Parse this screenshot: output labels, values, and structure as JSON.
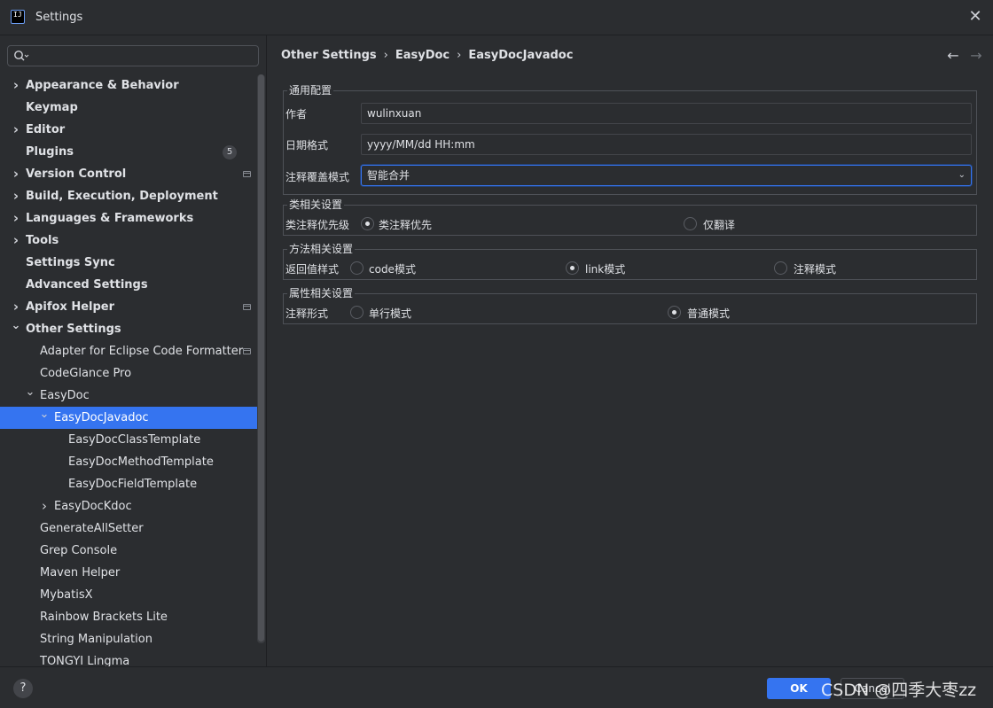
{
  "window": {
    "title": "Settings",
    "app_icon_text": "IJ"
  },
  "search": {
    "placeholder": "",
    "value": ""
  },
  "sidebar": {
    "items": [
      {
        "label": "Appearance & Behavior",
        "level": 0,
        "expandable": true,
        "expanded": false,
        "bold": true
      },
      {
        "label": "Keymap",
        "level": 0,
        "expandable": false,
        "bold": true
      },
      {
        "label": "Editor",
        "level": 0,
        "expandable": true,
        "expanded": false,
        "bold": true
      },
      {
        "label": "Plugins",
        "level": 0,
        "expandable": false,
        "bold": true,
        "badge": "5"
      },
      {
        "label": "Version Control",
        "level": 0,
        "expandable": true,
        "expanded": false,
        "bold": true,
        "project_icon": true
      },
      {
        "label": "Build, Execution, Deployment",
        "level": 0,
        "expandable": true,
        "expanded": false,
        "bold": true
      },
      {
        "label": "Languages & Frameworks",
        "level": 0,
        "expandable": true,
        "expanded": false,
        "bold": true
      },
      {
        "label": "Tools",
        "level": 0,
        "expandable": true,
        "expanded": false,
        "bold": true
      },
      {
        "label": "Settings Sync",
        "level": 0,
        "expandable": false,
        "bold": true
      },
      {
        "label": "Advanced Settings",
        "level": 0,
        "expandable": false,
        "bold": true
      },
      {
        "label": "Apifox Helper",
        "level": 0,
        "expandable": true,
        "expanded": false,
        "bold": true,
        "project_icon": true
      },
      {
        "label": "Other Settings",
        "level": 0,
        "expandable": true,
        "expanded": true,
        "bold": true
      },
      {
        "label": "Adapter for Eclipse Code Formatter",
        "level": 1,
        "expandable": false,
        "project_icon": true
      },
      {
        "label": "CodeGlance Pro",
        "level": 1,
        "expandable": false
      },
      {
        "label": "EasyDoc",
        "level": 1,
        "expandable": true,
        "expanded": true
      },
      {
        "label": "EasyDocJavadoc",
        "level": 2,
        "expandable": true,
        "expanded": true,
        "selected": true
      },
      {
        "label": "EasyDocClassTemplate",
        "level": 3,
        "expandable": false
      },
      {
        "label": "EasyDocMethodTemplate",
        "level": 3,
        "expandable": false
      },
      {
        "label": "EasyDocFieldTemplate",
        "level": 3,
        "expandable": false
      },
      {
        "label": "EasyDocKdoc",
        "level": 2,
        "expandable": true,
        "expanded": false
      },
      {
        "label": "GenerateAllSetter",
        "level": 1,
        "expandable": false
      },
      {
        "label": "Grep Console",
        "level": 1,
        "expandable": false
      },
      {
        "label": "Maven Helper",
        "level": 1,
        "expandable": false
      },
      {
        "label": "MybatisX",
        "level": 1,
        "expandable": false
      },
      {
        "label": "Rainbow Brackets Lite",
        "level": 1,
        "expandable": false
      },
      {
        "label": "String Manipulation",
        "level": 1,
        "expandable": false
      },
      {
        "label": "TONGYI Lingma",
        "level": 1,
        "expandable": false
      }
    ]
  },
  "breadcrumb": [
    "Other Settings",
    "EasyDoc",
    "EasyDocJavadoc"
  ],
  "nav": {
    "back": "←",
    "forward": "→"
  },
  "general_group": {
    "title": "通用配置",
    "author_label": "作者",
    "author_value": "wulinxuan",
    "date_label": "日期格式",
    "date_value": "yyyy/MM/dd HH:mm",
    "overwrite_label": "注释覆盖模式",
    "overwrite_value": "智能合并"
  },
  "class_group": {
    "title": "类相关设置",
    "label": "类注释优先级",
    "options": [
      {
        "label": "类注释优先",
        "checked": true
      },
      {
        "label": "仅翻译",
        "checked": false
      }
    ]
  },
  "method_group": {
    "title": "方法相关设置",
    "label": "返回值样式",
    "options": [
      {
        "label": "code模式",
        "checked": false
      },
      {
        "label": "link模式",
        "checked": true
      },
      {
        "label": "注释模式",
        "checked": false
      }
    ]
  },
  "field_group": {
    "title": "属性相关设置",
    "label": "注释形式",
    "options": [
      {
        "label": "单行模式",
        "checked": false
      },
      {
        "label": "普通模式",
        "checked": true
      }
    ]
  },
  "footer": {
    "help": "?",
    "ok": "OK",
    "cancel": "Cancel",
    "watermark": "CSDN @四季大枣zz"
  },
  "colors": {
    "accent": "#3574f0",
    "background": "#2b2d30",
    "selection": "#3574f0"
  }
}
